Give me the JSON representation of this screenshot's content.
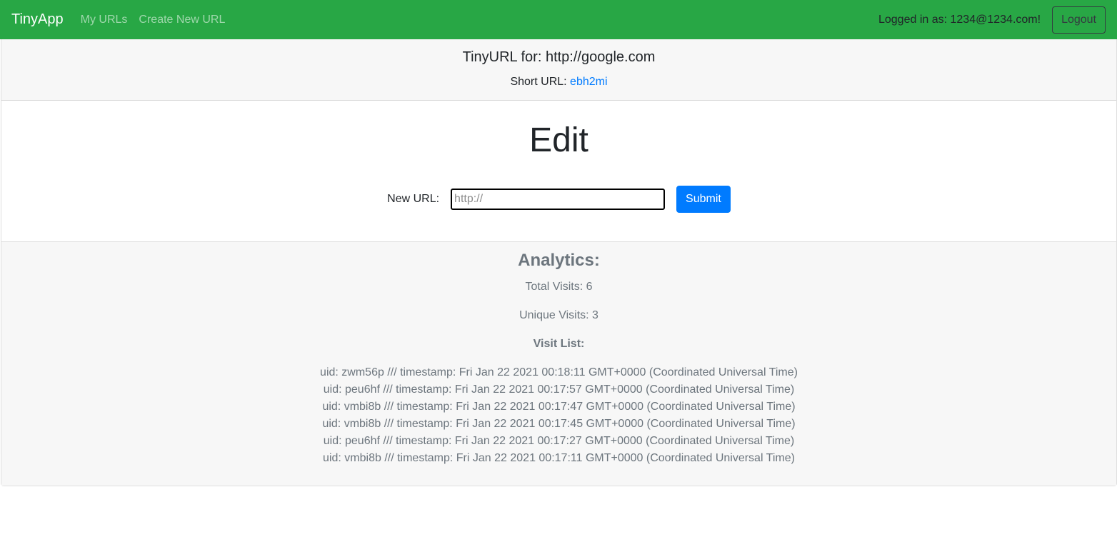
{
  "navbar": {
    "brand": "TinyApp",
    "links": [
      "My URLs",
      "Create New URL"
    ],
    "logged_in_text": "Logged in as: 1234@1234.com!",
    "logout_label": "Logout",
    "bg_color": "#28a745"
  },
  "header": {
    "title": "TinyURL for: http://google.com",
    "short_url_label": "Short URL:",
    "short_url_value": "ebh2mi"
  },
  "edit": {
    "title": "Edit",
    "new_url_label": "New URL:",
    "new_url_placeholder": "http://",
    "new_url_value": "",
    "submit_label": "Submit",
    "submit_color": "#007bff"
  },
  "analytics": {
    "title": "Analytics:",
    "total_visits": "Total Visits: 6",
    "unique_visits": "Unique Visits: 3",
    "visit_list_title": "Visit List:",
    "visits": [
      "uid: zwm56p /// timestamp: Fri Jan 22 2021 00:18:11 GMT+0000 (Coordinated Universal Time)",
      "uid: peu6hf /// timestamp: Fri Jan 22 2021 00:17:57 GMT+0000 (Coordinated Universal Time)",
      "uid: vmbi8b /// timestamp: Fri Jan 22 2021 00:17:47 GMT+0000 (Coordinated Universal Time)",
      "uid: vmbi8b /// timestamp: Fri Jan 22 2021 00:17:45 GMT+0000 (Coordinated Universal Time)",
      "uid: peu6hf /// timestamp: Fri Jan 22 2021 00:17:27 GMT+0000 (Coordinated Universal Time)",
      "uid: vmbi8b /// timestamp: Fri Jan 22 2021 00:17:11 GMT+0000 (Coordinated Universal Time)"
    ]
  }
}
